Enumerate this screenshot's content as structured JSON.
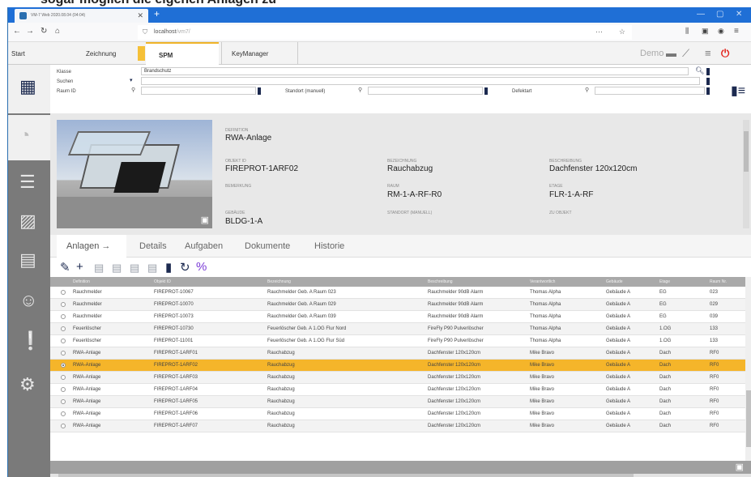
{
  "page_heading": "sogar möglich die eigenen Anlagen zu",
  "browser": {
    "tab_title": "VM-7 Web 2020.08.04 (04:04)",
    "url_host": "localhost",
    "url_path": "/vm7/",
    "icons": {
      "back": "back-arrow-icon",
      "forward": "forward-arrow-icon",
      "reload": "reload-icon",
      "home": "home-icon",
      "library": "library-icon",
      "sidebar": "sidebar-icon",
      "account": "account-icon",
      "menu": "hamburger-menu-icon"
    }
  },
  "app_menu": {
    "start": "Start",
    "zeichnung": "Zeichnung",
    "spm": "SPM",
    "keymanager": "KeyManager",
    "user": "Demo"
  },
  "filter": {
    "klasse_label": "Klasse",
    "klasse_value": "Brandschutz",
    "suchen_label": "Suchen",
    "raum_label": "Raum ID",
    "standort_label": "Standort (manuell)",
    "defektart_label": "Defektart"
  },
  "detail": {
    "definition_label": "DEFINITION",
    "definition_value": "RWA-Anlage",
    "objekt_label": "OBJEKT ID",
    "objekt_value": "FIREPROT-1ARF02",
    "bezeichnung_label": "BEZEICHNUNG",
    "bezeichnung_value": "Rauchabzug",
    "beschreibung_label": "BESCHREIBUNG",
    "beschreibung_value": "Dachfenster 120x120cm",
    "bemerkung_label": "BEMERKUNG",
    "raum_label": "RAUM",
    "raum_value": "RM-1-A-RF-R0",
    "etage_label": "ETAGE",
    "etage_value": "FLR-1-A-RF",
    "gebaeude_label": "GEBÄUDE",
    "gebaeude_value": "BLDG-1-A",
    "standort_label": "STANDORT (MANUELL)",
    "zu_objekt_label": "ZU OBJEKT"
  },
  "tabs": {
    "anlagen": "Anlagen →",
    "details": "Details",
    "aufgaben": "Aufgaben",
    "dokumente": "Dokumente",
    "historie": "Historie"
  },
  "table": {
    "columns": [
      "Definition",
      "Objekt ID",
      "Bezeichnung",
      "Beschreibung",
      "Verantwortlich",
      "Gebäude",
      "Etage",
      "Raum Nr."
    ],
    "rows": [
      [
        "Rauchmelder",
        "FIREPROT-10067",
        "Rauchmelder Geb. A Raum 023",
        "Rauchmelder 90dB Alarm",
        "Thomas Alpha",
        "Gebäude A",
        "EG",
        "023"
      ],
      [
        "Rauchmelder",
        "FIREPROT-10070",
        "Rauchmelder Geb. A Raum 029",
        "Rauchmelder 90dB Alarm",
        "Thomas Alpha",
        "Gebäude A",
        "EG",
        "029"
      ],
      [
        "Rauchmelder",
        "FIREPROT-10073",
        "Rauchmelder Geb. A Raum 039",
        "Rauchmelder 90dB Alarm",
        "Thomas Alpha",
        "Gebäude A",
        "EG",
        "039"
      ],
      [
        "Feuerlöscher",
        "FIREPROT-10730",
        "Feuerlöscher Geb. A 1.OG Flur Nord",
        "FireFly P90 Pulverlöscher",
        "Thomas Alpha",
        "Gebäude A",
        "1.OG",
        "133"
      ],
      [
        "Feuerlöscher",
        "FIREPROT-11001",
        "Feuerlöscher Geb. A 1.OG Flur Süd",
        "FireFly P90 Pulverlöscher",
        "Thomas Alpha",
        "Gebäude A",
        "1.OG",
        "133"
      ],
      [
        "RWA-Anlage",
        "FIREPROT-1ARF01",
        "Rauchabzug",
        "Dachfenster 120x120cm",
        "Mike Bravo",
        "Gebäude A",
        "Dach",
        "RF0"
      ],
      [
        "RWA-Anlage",
        "FIREPROT-1ARF02",
        "Rauchabzug",
        "Dachfenster 120x120cm",
        "Mike Bravo",
        "Gebäude A",
        "Dach",
        "RF0"
      ],
      [
        "RWA-Anlage",
        "FIREPROT-1ARF03",
        "Rauchabzug",
        "Dachfenster 120x120cm",
        "Mike Bravo",
        "Gebäude A",
        "Dach",
        "RF0"
      ],
      [
        "RWA-Anlage",
        "FIREPROT-1ARF04",
        "Rauchabzug",
        "Dachfenster 120x120cm",
        "Mike Bravo",
        "Gebäude A",
        "Dach",
        "RF0"
      ],
      [
        "RWA-Anlage",
        "FIREPROT-1ARF05",
        "Rauchabzug",
        "Dachfenster 120x120cm",
        "Mike Bravo",
        "Gebäude A",
        "Dach",
        "RF0"
      ],
      [
        "RWA-Anlage",
        "FIREPROT-1ARF06",
        "Rauchabzug",
        "Dachfenster 120x120cm",
        "Mike Bravo",
        "Gebäude A",
        "Dach",
        "RF0"
      ],
      [
        "RWA-Anlage",
        "FIREPROT-1ARF07",
        "Rauchabzug",
        "Dachfenster 120x120cm",
        "Mike Bravo",
        "Gebäude A",
        "Dach",
        "RF0"
      ]
    ],
    "selected_row": 6
  },
  "colors": {
    "brand_blue": "#1f6fd6",
    "accent_yellow": "#f5b52a",
    "power_red": "#e3231b",
    "icon_navy": "#1c2a50"
  }
}
